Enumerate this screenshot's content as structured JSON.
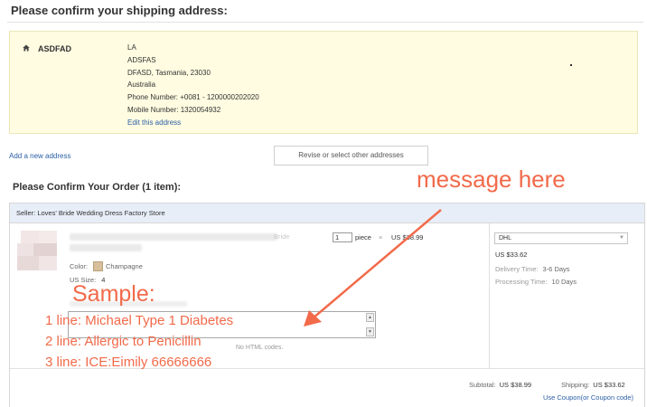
{
  "shipping_section": {
    "title": "Please confirm your shipping address:"
  },
  "address": {
    "icon": "home-icon",
    "name": "ASDFAD",
    "lines": [
      "LA",
      "ADSFAS",
      "DFASD, Tasmania, 23030",
      "Australia",
      "Phone Number:  +0081 - 1200000202020",
      "Mobile Number:  1320054932"
    ],
    "edit_label": "Edit this address"
  },
  "actions": {
    "add_address": "Add a new address",
    "revise_addresses": "Revise or select other addresses"
  },
  "order_section": {
    "title": "Please Confirm Your Order (1 item):"
  },
  "seller": {
    "label": "Seller: Loves' Bride Wedding Dress Factory Store"
  },
  "product": {
    "color_label": "Color:",
    "color_value": "Champagne",
    "size_label": "US Size:",
    "size_value": "4",
    "quantity": "1",
    "unit": "piece",
    "times": "×",
    "unit_price": "US $38.99"
  },
  "shipping_method": {
    "carrier": "DHL",
    "price": "US $33.62",
    "delivery_label": "Delivery Time:",
    "delivery_value": "3-6 Days",
    "processing_label": "Processing Time:",
    "processing_value": "10 Days"
  },
  "message": {
    "note_value": "No HTML codes."
  },
  "totals": {
    "subtotal_label": "Subtotal:",
    "subtotal_value": "US $38.99",
    "shipping_label": "Shipping:",
    "shipping_value": "US $33.62",
    "coupon_link": "Use Coupon(or Coupon code)"
  },
  "annotations": {
    "message_here": "message here",
    "sample": "Sample:",
    "lines": [
      "1 line: Michael Type 1 Diabetes",
      "2 line: Allergic to Penicillin",
      "3 line: ICE:Eimily 66666666"
    ],
    "color": "#f26a4a"
  }
}
